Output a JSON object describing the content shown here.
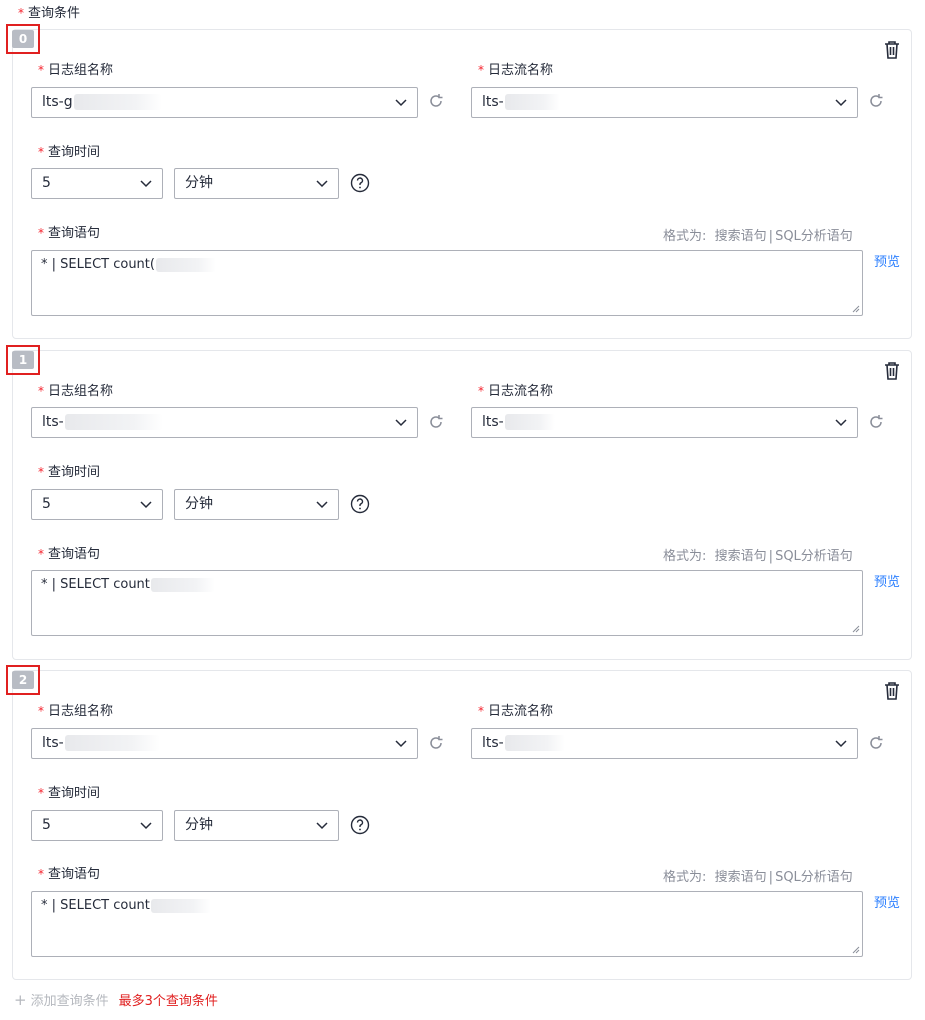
{
  "section": {
    "required_mark": "*",
    "title": "查询条件"
  },
  "labels": {
    "log_group": "日志组名称",
    "log_stream": "日志流名称",
    "query_time": "查询时间",
    "query_statement": "查询语句",
    "format_prefix": "格式为:",
    "format_search": "搜索语句",
    "format_sep": "|",
    "format_sql": "SQL分析语句",
    "preview": "预览"
  },
  "conditions": [
    {
      "index": "0",
      "log_group": "lts-g",
      "log_stream": "lts-",
      "time_value": "5",
      "time_unit": "分钟",
      "query": "* | SELECT count("
    },
    {
      "index": "1",
      "log_group": "lts-",
      "log_stream": "lts-",
      "time_value": "5",
      "time_unit": "分钟",
      "query": "* | SELECT count"
    },
    {
      "index": "2",
      "log_group": "lts-",
      "log_stream": "lts-",
      "time_value": "5",
      "time_unit": "分钟",
      "query": "* | SELECT count"
    }
  ],
  "footer": {
    "add_label": "添加查询条件",
    "limit_text": "最多3个查询条件"
  },
  "icons": {
    "delete": "trash-icon",
    "refresh": "refresh-icon",
    "help": "help-circle-icon",
    "dropdown": "chevron-down-icon",
    "add": "plus-icon"
  },
  "colors": {
    "required": "#f5222d",
    "highlight_frame": "#e02020",
    "link": "#2b7fff",
    "limit": "#e02020"
  }
}
